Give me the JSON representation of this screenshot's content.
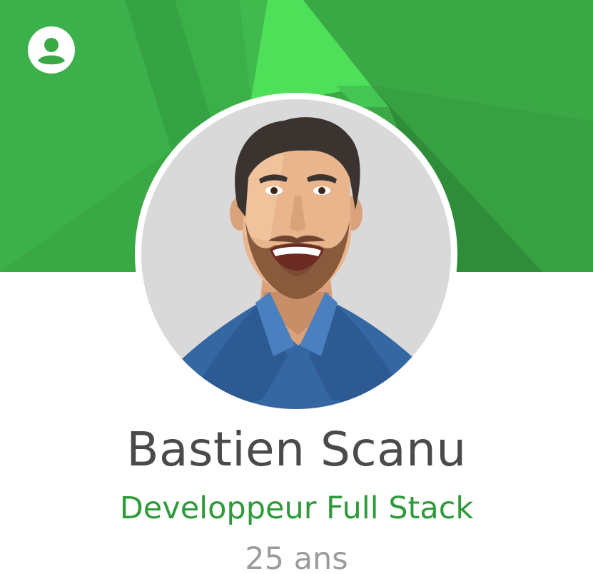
{
  "profile": {
    "name": "Bastien Scanu",
    "title": "Developpeur Full Stack",
    "age": "25 ans"
  },
  "header": {
    "icon": "account-circle-icon"
  },
  "colors": {
    "banner_green": "#3aa844",
    "banner_light": "#4fe05a",
    "name_text": "#4a4a4a",
    "title_text": "#2e9a3a",
    "age_text": "#9b9b9b",
    "avatar_bg": "#d9d9d9",
    "shirt": "#3567a3"
  }
}
